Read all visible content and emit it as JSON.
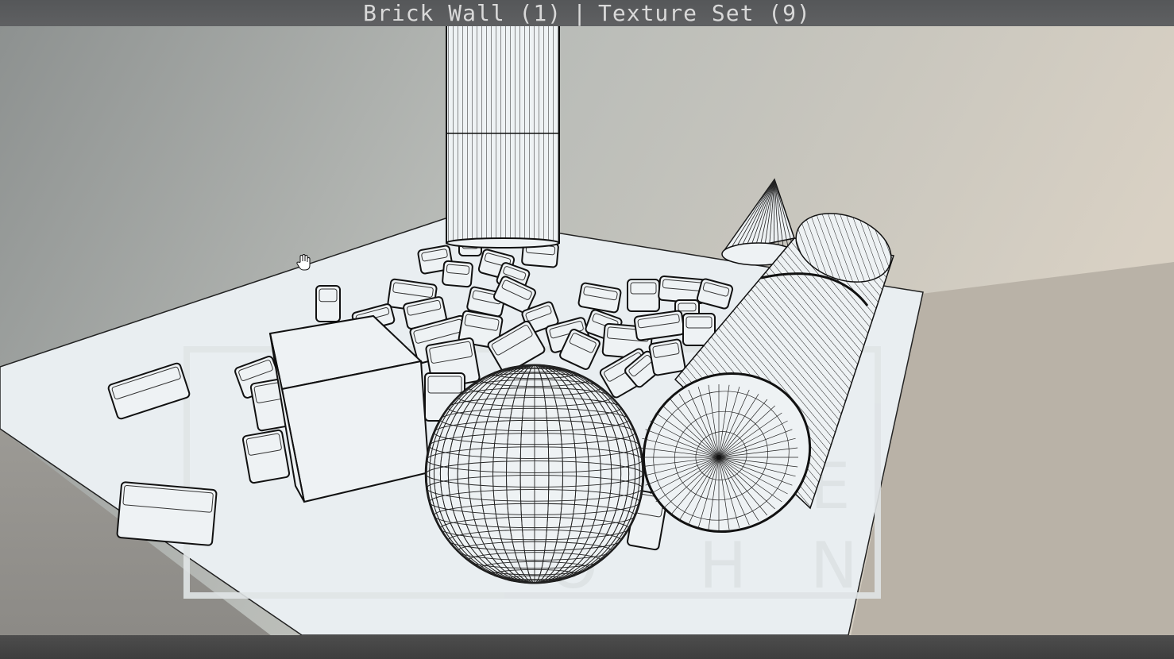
{
  "title": {
    "left": "Brick Wall (1)",
    "separator": "|",
    "right": "Texture Set (9)"
  },
  "watermark_letters": [
    "E",
    "O",
    "H",
    "N"
  ],
  "colors": {
    "background_left": "#8e918f",
    "background_right": "#d8d0c3",
    "ground": "#e9eef1",
    "wire": "#111111",
    "titlebar": "#5a5b5d"
  },
  "icons": {
    "cursor": "hand-cursor-icon"
  }
}
